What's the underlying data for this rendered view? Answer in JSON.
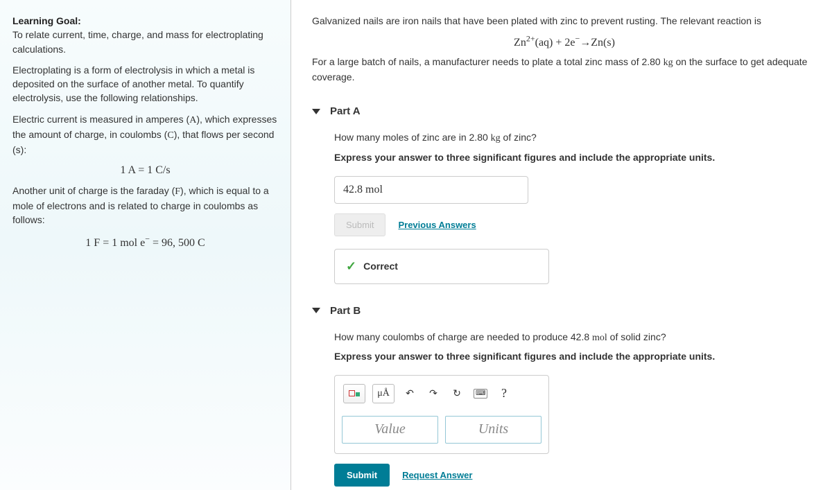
{
  "left": {
    "goal_label": "Learning Goal:",
    "goal_text": "To relate current, time, charge, and mass for electroplating calculations.",
    "para1": "Electroplating is a form of electrolysis in which a metal is deposited on the surface of another metal. To quantify electrolysis, use the following relationships.",
    "para2_a": "Electric current is measured in amperes (",
    "para2_b": "), which expresses the amount of charge, in coulombs (",
    "para2_c": "), that flows per second (s):",
    "eq1": "1 A = 1 C/s",
    "para3_a": "Another unit of charge is the faraday (",
    "para3_b": "), which is equal to a mole of electrons and is related to charge in coulombs as follows:",
    "eq2_a": "1 F = 1 mol e",
    "eq2_b": " = 96, 500 C"
  },
  "right": {
    "intro1": "Galvanized nails are iron nails that have been plated with zinc to prevent rusting. The relevant reaction is",
    "reaction_a": "Zn",
    "reaction_b": "(aq) + 2e",
    "reaction_c": "→Zn(s)",
    "intro2_a": "For a large batch of nails, a manufacturer needs to plate a total zinc mass of 2.80 ",
    "intro2_b": " on the surface to get adequate coverage.",
    "kg": "kg",
    "mol": "mol",
    "partA": {
      "title": "Part A",
      "q1": "How many moles of zinc are in 2.80 ",
      "q2": " of zinc?",
      "instr": "Express your answer to three significant figures and include the appropriate units.",
      "answer": "42.8 mol",
      "submit": "Submit",
      "prev": "Previous Answers",
      "correct": "Correct"
    },
    "partB": {
      "title": "Part B",
      "q1": "How many coulombs of charge are needed to produce 42.8 ",
      "q2": " of solid zinc?",
      "instr": "Express your answer to three significant figures and include the appropriate units.",
      "value_ph": "Value",
      "units_ph": "Units",
      "submit": "Submit",
      "request": "Request Answer",
      "special_char": "μÅ",
      "help": "?"
    }
  }
}
